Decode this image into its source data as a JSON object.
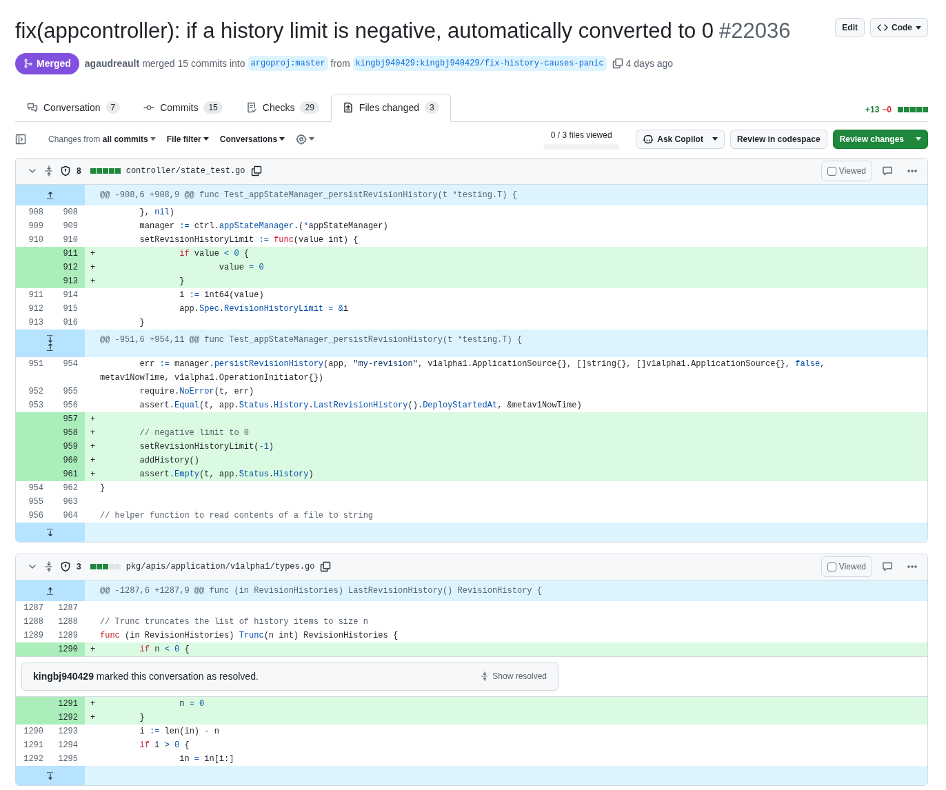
{
  "pull_request": {
    "title": "fix(appcontroller): if a history limit is negative, automatically converted to 0",
    "number": "#22036",
    "actions": [
      "Edit",
      "Code"
    ],
    "state": {
      "kind": "merged",
      "label": "Merged"
    },
    "author": "agaudreault",
    "merge_text": "merged 15 commits into",
    "base_branch": "argoproj:master",
    "from_text": "from",
    "head_branch": "kingbj940429:kingbj940429/fix-history-causes-panic",
    "time": "4 days ago"
  },
  "tabs": [
    {
      "kind": "conversation",
      "label": "Conversation",
      "count": "7",
      "selected": false
    },
    {
      "kind": "commits",
      "label": "Commits",
      "count": "15",
      "selected": false
    },
    {
      "kind": "checks",
      "label": "Checks",
      "count": "29",
      "selected": false
    },
    {
      "kind": "files",
      "label": "Files changed",
      "count": "3",
      "selected": true
    }
  ],
  "diff_summary": {
    "additions": "+13",
    "deletions": "−0",
    "stat_blocks": [
      {
        "added": true
      },
      {
        "added": true
      },
      {
        "added": true
      },
      {
        "added": true
      },
      {
        "added": true
      }
    ]
  },
  "toolbar": {
    "filters": [
      "Changes from **all commits**",
      "File filter",
      "Conversations"
    ],
    "progress": {
      "label": "0 / 3 files viewed",
      "level": 0
    },
    "buttons": [
      {
        "kind": "copilot",
        "label": "Ask Copilot"
      },
      {
        "kind": "plain",
        "label": "Review in codespace"
      },
      {
        "kind": "primary",
        "label": "Review changes"
      }
    ]
  },
  "files": [
    {
      "path": "controller/state_test.go",
      "changes": "8",
      "stat_blocks": [
        {
          "added": true
        },
        {
          "added": true
        },
        {
          "added": true
        },
        {
          "added": true
        },
        {
          "added": true
        }
      ],
      "expanded": true,
      "viewed": false,
      "viewed_label": "Viewed",
      "rows": [
        {
          "kind": "hunk",
          "expand_up": true,
          "expand_down": false,
          "text": "@@ -908,6 +908,9 @@ func Test_appStateManager_persistRevisionHistory(t *testing.T) {"
        },
        {
          "kind": "context",
          "old": "908",
          "new": "908",
          "tokens": [
            {
              "kind": "plain",
              "text": "\t}, "
            },
            {
              "kind": "entity",
              "text": "nil"
            },
            {
              "kind": "plain",
              "text": ")"
            }
          ]
        },
        {
          "kind": "context",
          "old": "909",
          "new": "909",
          "tokens": [
            {
              "kind": "plain",
              "text": "\tmanager "
            },
            {
              "kind": "entity",
              "text": ":="
            },
            {
              "kind": "plain",
              "text": " ctrl."
            },
            {
              "kind": "entity",
              "text": "appStateManager"
            },
            {
              "kind": "plain",
              "text": ".("
            },
            {
              "kind": "entity",
              "text": "*"
            },
            {
              "kind": "plain",
              "text": "appStateManager)"
            }
          ]
        },
        {
          "kind": "context",
          "old": "910",
          "new": "910",
          "tokens": [
            {
              "kind": "plain",
              "text": "\tsetRevisionHistoryLimit "
            },
            {
              "kind": "entity",
              "text": ":= "
            },
            {
              "kind": "keyword",
              "text": "func"
            },
            {
              "kind": "plain",
              "text": "(value int) {"
            }
          ]
        },
        {
          "kind": "addition",
          "new": "911",
          "marker": "+",
          "tokens": [
            {
              "kind": "keyword",
              "text": "\t\tif"
            },
            {
              "kind": "plain",
              "text": " value "
            },
            {
              "kind": "entity",
              "text": "< 0"
            },
            {
              "kind": "plain",
              "text": " {"
            }
          ]
        },
        {
          "kind": "addition",
          "new": "912",
          "marker": "+",
          "tokens": [
            {
              "kind": "plain",
              "text": "\t\t\tvalue "
            },
            {
              "kind": "entity",
              "text": "= 0"
            }
          ]
        },
        {
          "kind": "addition",
          "new": "913",
          "marker": "+",
          "tokens": [
            {
              "kind": "plain",
              "text": "\t\t}"
            }
          ]
        },
        {
          "kind": "context",
          "old": "911",
          "new": "914",
          "tokens": [
            {
              "kind": "plain",
              "text": "\t\ti "
            },
            {
              "kind": "entity",
              "text": ":="
            },
            {
              "kind": "plain",
              "text": " int64(value)"
            }
          ]
        },
        {
          "kind": "context",
          "old": "912",
          "new": "915",
          "tokens": [
            {
              "kind": "plain",
              "text": "\t\tapp."
            },
            {
              "kind": "entity",
              "text": "Spec"
            },
            {
              "kind": "plain",
              "text": "."
            },
            {
              "kind": "entity",
              "text": "RevisionHistoryLimit = &"
            },
            {
              "kind": "plain",
              "text": "i"
            }
          ]
        },
        {
          "kind": "context",
          "old": "913",
          "new": "916",
          "tokens": [
            {
              "kind": "plain",
              "text": "\t}"
            }
          ]
        },
        {
          "kind": "hunk",
          "expand_up": true,
          "expand_down": true,
          "text": "@@ -951,6 +954,11 @@ func Test_appStateManager_persistRevisionHistory(t *testing.T) {"
        },
        {
          "kind": "context",
          "old": "951",
          "new": "954",
          "tokens": [
            {
              "kind": "plain",
              "text": "\terr "
            },
            {
              "kind": "entity",
              "text": ":="
            },
            {
              "kind": "plain",
              "text": " manager."
            },
            {
              "kind": "entity",
              "text": "persistRevisionHistory"
            },
            {
              "kind": "plain",
              "text": "(app, "
            },
            {
              "kind": "string",
              "text": "\"my-revision\""
            },
            {
              "kind": "plain",
              "text": ", v1alpha1.ApplicationSource{}, []string{}, []v1alpha1.ApplicationSource{}, "
            },
            {
              "kind": "entity",
              "text": "false"
            },
            {
              "kind": "plain",
              "text": ", metav1NowTime, v1alpha1.OperationInitiator{})"
            }
          ]
        },
        {
          "kind": "context",
          "old": "952",
          "new": "955",
          "tokens": [
            {
              "kind": "plain",
              "text": "\trequire."
            },
            {
              "kind": "entity",
              "text": "NoError"
            },
            {
              "kind": "plain",
              "text": "(t, err)"
            }
          ]
        },
        {
          "kind": "context",
          "old": "953",
          "new": "956",
          "tokens": [
            {
              "kind": "plain",
              "text": "\tassert."
            },
            {
              "kind": "entity",
              "text": "Equal"
            },
            {
              "kind": "plain",
              "text": "(t, app."
            },
            {
              "kind": "entity",
              "text": "Status"
            },
            {
              "kind": "plain",
              "text": "."
            },
            {
              "kind": "entity",
              "text": "History"
            },
            {
              "kind": "plain",
              "text": "."
            },
            {
              "kind": "entity",
              "text": "LastRevisionHistory"
            },
            {
              "kind": "plain",
              "text": "()."
            },
            {
              "kind": "entity",
              "text": "DeployStartedAt"
            },
            {
              "kind": "plain",
              "text": ", &metav1NowTime)"
            }
          ]
        },
        {
          "kind": "addition",
          "new": "957",
          "marker": "+",
          "tokens": []
        },
        {
          "kind": "addition",
          "new": "958",
          "marker": "+",
          "tokens": [
            {
              "kind": "comment",
              "text": "\t// negative limit to 0"
            }
          ]
        },
        {
          "kind": "addition",
          "new": "959",
          "marker": "+",
          "tokens": [
            {
              "kind": "plain",
              "text": "\tsetRevisionHistoryLimit("
            },
            {
              "kind": "entity",
              "text": "-1"
            },
            {
              "kind": "plain",
              "text": ")"
            }
          ]
        },
        {
          "kind": "addition",
          "new": "960",
          "marker": "+",
          "tokens": [
            {
              "kind": "plain",
              "text": "\taddHistory()"
            }
          ]
        },
        {
          "kind": "addition",
          "new": "961",
          "marker": "+",
          "tokens": [
            {
              "kind": "plain",
              "text": "\tassert."
            },
            {
              "kind": "entity",
              "text": "Empty"
            },
            {
              "kind": "plain",
              "text": "(t, app."
            },
            {
              "kind": "entity",
              "text": "Status"
            },
            {
              "kind": "plain",
              "text": "."
            },
            {
              "kind": "entity",
              "text": "History"
            },
            {
              "kind": "plain",
              "text": ")"
            }
          ]
        },
        {
          "kind": "context",
          "old": "954",
          "new": "962",
          "tokens": [
            {
              "kind": "plain",
              "text": "}"
            }
          ]
        },
        {
          "kind": "context",
          "old": "955",
          "new": "963",
          "tokens": []
        },
        {
          "kind": "context",
          "old": "956",
          "new": "964",
          "tokens": [
            {
              "kind": "comment",
              "text": "// helper function to read contents of a file to string"
            }
          ]
        },
        {
          "kind": "hunk",
          "expand_up": false,
          "expand_down": true
        }
      ]
    },
    {
      "path": "pkg/apis/application/v1alpha1/types.go",
      "changes": "3",
      "stat_blocks": [
        {
          "added": true
        },
        {
          "added": true
        },
        {
          "added": true
        },
        {
          "added": false
        },
        {
          "added": false
        }
      ],
      "expanded": true,
      "viewed": false,
      "viewed_label": "Viewed",
      "rows": [
        {
          "kind": "hunk",
          "expand_up": true,
          "expand_down": false,
          "text": "@@ -1287,6 +1287,9 @@ func (in RevisionHistories) LastRevisionHistory() RevisionHistory {"
        },
        {
          "kind": "context",
          "old": "1287",
          "new": "1287",
          "tokens": []
        },
        {
          "kind": "context",
          "old": "1288",
          "new": "1288",
          "tokens": [
            {
              "kind": "comment",
              "text": "// Trunc truncates the list of history items to size n"
            }
          ]
        },
        {
          "kind": "context",
          "old": "1289",
          "new": "1289",
          "tokens": [
            {
              "kind": "keyword",
              "text": "func"
            },
            {
              "kind": "plain",
              "text": " (in RevisionHistories) "
            },
            {
              "kind": "entity",
              "text": "Trunc"
            },
            {
              "kind": "plain",
              "text": "(n int) RevisionHistories {"
            }
          ]
        },
        {
          "kind": "addition",
          "new": "1290",
          "marker": "+",
          "tokens": [
            {
              "kind": "keyword",
              "text": "\tif"
            },
            {
              "kind": "plain",
              "text": " n "
            },
            {
              "kind": "entity",
              "text": "< 0"
            },
            {
              "kind": "plain",
              "text": " {"
            }
          ]
        },
        {
          "kind": "conversation",
          "text": "**kingbj940429** marked this conversation as resolved.",
          "action": "Show resolved"
        },
        {
          "kind": "addition",
          "new": "1291",
          "marker": "+",
          "tokens": [
            {
              "kind": "plain",
              "text": "\t\tn "
            },
            {
              "kind": "entity",
              "text": "= 0"
            }
          ]
        },
        {
          "kind": "addition",
          "new": "1292",
          "marker": "+",
          "tokens": [
            {
              "kind": "plain",
              "text": "\t}"
            }
          ]
        },
        {
          "kind": "context",
          "old": "1290",
          "new": "1293",
          "tokens": [
            {
              "kind": "plain",
              "text": "\ti "
            },
            {
              "kind": "entity",
              "text": ":="
            },
            {
              "kind": "plain",
              "text": " len(in) "
            },
            {
              "kind": "entity",
              "text": "-"
            },
            {
              "kind": "plain",
              "text": " n"
            }
          ]
        },
        {
          "kind": "context",
          "old": "1291",
          "new": "1294",
          "tokens": [
            {
              "kind": "keyword",
              "text": "\tif"
            },
            {
              "kind": "plain",
              "text": " i "
            },
            {
              "kind": "entity",
              "text": "> 0"
            },
            {
              "kind": "plain",
              "text": " {"
            }
          ]
        },
        {
          "kind": "context",
          "old": "1292",
          "new": "1295",
          "tokens": [
            {
              "kind": "plain",
              "text": "\t\tin "
            },
            {
              "kind": "entity",
              "text": "="
            },
            {
              "kind": "plain",
              "text": " in[i:]"
            }
          ]
        },
        {
          "kind": "hunk",
          "expand_up": false,
          "expand_down": true
        }
      ]
    }
  ]
}
